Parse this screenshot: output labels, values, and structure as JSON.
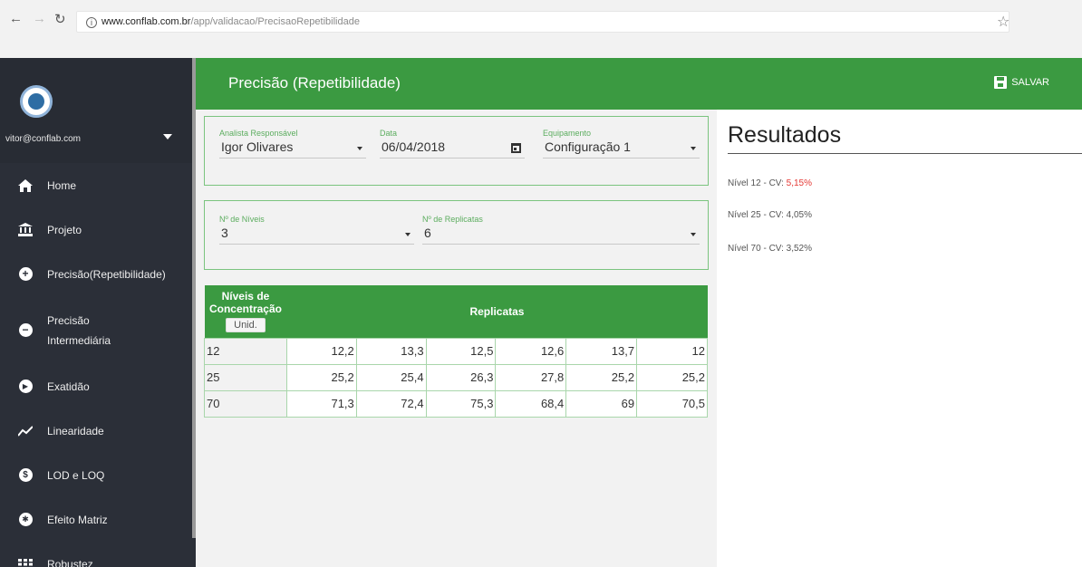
{
  "browser": {
    "url_host": "www.conflab.com.br",
    "url_path": "/app/validacao/PrecisaoRepetibilidade"
  },
  "sidebar": {
    "user_email": "vitor@conflab.com",
    "items": [
      {
        "label": "Home"
      },
      {
        "label": "Projeto"
      },
      {
        "label": "Precisão(Repetibilidade)"
      },
      {
        "label": "Precisão Intermediária"
      },
      {
        "label": "Exatidão"
      },
      {
        "label": "Linearidade"
      },
      {
        "label": "LOD e LOQ"
      },
      {
        "label": "Efeito Matriz"
      },
      {
        "label": "Robustez"
      }
    ]
  },
  "header": {
    "title": "Precisão (Repetibilidade)",
    "save_label": "SALVAR"
  },
  "form": {
    "analyst_label": "Analista Responsável",
    "analyst_value": "Igor Olivares",
    "date_label": "Data",
    "date_value": "06/04/2018",
    "equipment_label": "Equipamento",
    "equipment_value": "Configuração 1",
    "levels_label": "Nº de Níveis",
    "levels_value": "3",
    "replicates_label": "Nº de Replicatas",
    "replicates_value": "6"
  },
  "table": {
    "col_levels": "Níveis de Concentração",
    "unit_button": "Unid.",
    "col_replicates": "Replicatas",
    "rows": [
      {
        "level": "12",
        "values": [
          "12,2",
          "13,3",
          "12,5",
          "12,6",
          "13,7",
          "12"
        ]
      },
      {
        "level": "25",
        "values": [
          "25,2",
          "25,4",
          "26,3",
          "27,8",
          "25,2",
          "25,2"
        ]
      },
      {
        "level": "70",
        "values": [
          "71,3",
          "72,4",
          "75,3",
          "68,4",
          "69",
          "70,5"
        ]
      }
    ]
  },
  "results": {
    "title": "Resultados",
    "items": [
      {
        "prefix": "Nível 12 - CV: ",
        "value": "5,15%",
        "highlight": true
      },
      {
        "prefix": "Nível 25 - CV: ",
        "value": "4,05%",
        "highlight": false
      },
      {
        "prefix": "Nível 70 - CV: ",
        "value": "3,52%",
        "highlight": false
      }
    ]
  },
  "colors": {
    "primary_green": "#3b9a41",
    "sidebar_bg": "#2b2f38",
    "warning_red": "#e53935"
  }
}
